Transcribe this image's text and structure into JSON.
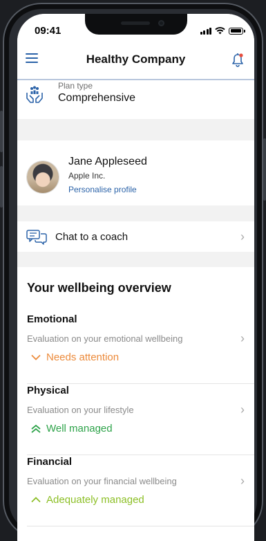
{
  "status_bar": {
    "time": "09:41"
  },
  "header": {
    "title": "Healthy Company"
  },
  "plan": {
    "label": "Plan type",
    "value": "Comprehensive"
  },
  "profile": {
    "name": "Jane Appleseed",
    "company": "Apple Inc.",
    "link_label": "Personalise profile"
  },
  "coach": {
    "label": "Chat to a coach"
  },
  "overview": {
    "title": "Your wellbeing overview",
    "items": [
      {
        "name": "Emotional",
        "description": "Evaluation on your emotional wellbeing",
        "status": "Needs attention",
        "status_color": "#ec8a3a",
        "status_icon": "chevron-down-icon"
      },
      {
        "name": "Physical",
        "description": "Evaluation on your lifestyle",
        "status": "Well managed",
        "status_color": "#2ea34a",
        "status_icon": "double-chevron-up-icon"
      },
      {
        "name": "Financial",
        "description": "Evaluation on your financial wellbeing",
        "status": "Adequately managed",
        "status_color": "#8cbf26",
        "status_icon": "chevron-up-icon"
      }
    ]
  },
  "colors": {
    "accent": "#2a62a8",
    "background": "#f2f2f2",
    "header_border": "#b8c6dc"
  }
}
